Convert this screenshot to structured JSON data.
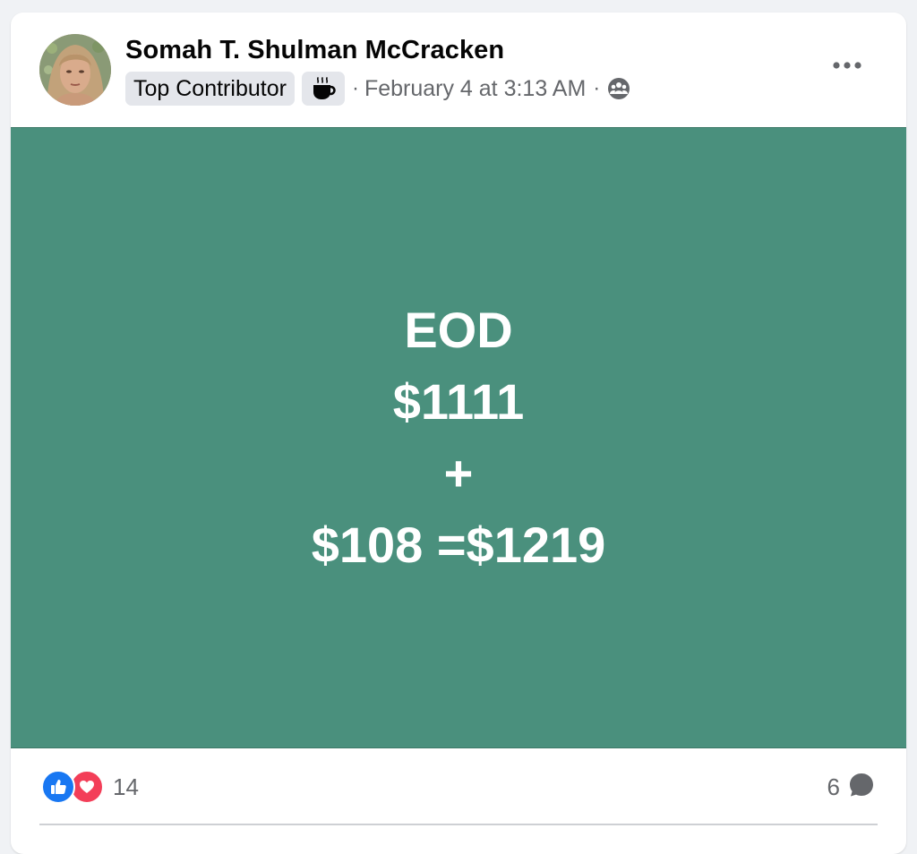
{
  "post": {
    "author_name": "Somah T. Shulman McCracken",
    "badge_label": "Top Contributor",
    "badge_icon": "coffee-cup-icon",
    "separator": "·",
    "timestamp": "February 4 at 3:13 AM",
    "audience_icon": "group-icon",
    "more_icon": "more-options-icon",
    "background_color": "#4a907d",
    "lines": [
      "EOD",
      "$1111",
      "+",
      "$108 =$1219"
    ]
  },
  "footer": {
    "reaction_icons": [
      "like-icon",
      "love-icon"
    ],
    "reaction_count": "14",
    "comment_count": "6",
    "comment_icon": "comment-bubble-icon"
  },
  "colors": {
    "like": "#1877f2",
    "love": "#f33e58",
    "secondary_text": "#65676b"
  }
}
